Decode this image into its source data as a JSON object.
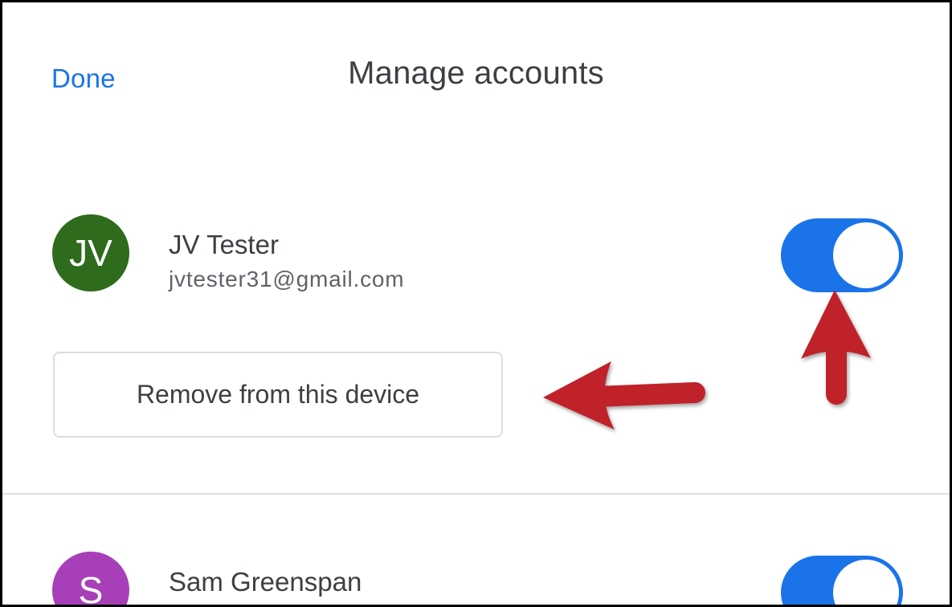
{
  "header": {
    "done_label": "Done",
    "title": "Manage accounts"
  },
  "accounts": [
    {
      "initials": "JV",
      "name": "JV Tester",
      "email": "jvtester31@gmail.com",
      "avatar_color": "#2e6b1c",
      "toggle_on": true,
      "remove_label": "Remove from this device"
    },
    {
      "initials": "S",
      "name": "Sam Greenspan",
      "avatar_color": "#a63fb8",
      "toggle_on": true
    }
  ],
  "colors": {
    "accent": "#1a73e8",
    "annotation_arrow": "#c0222b"
  }
}
